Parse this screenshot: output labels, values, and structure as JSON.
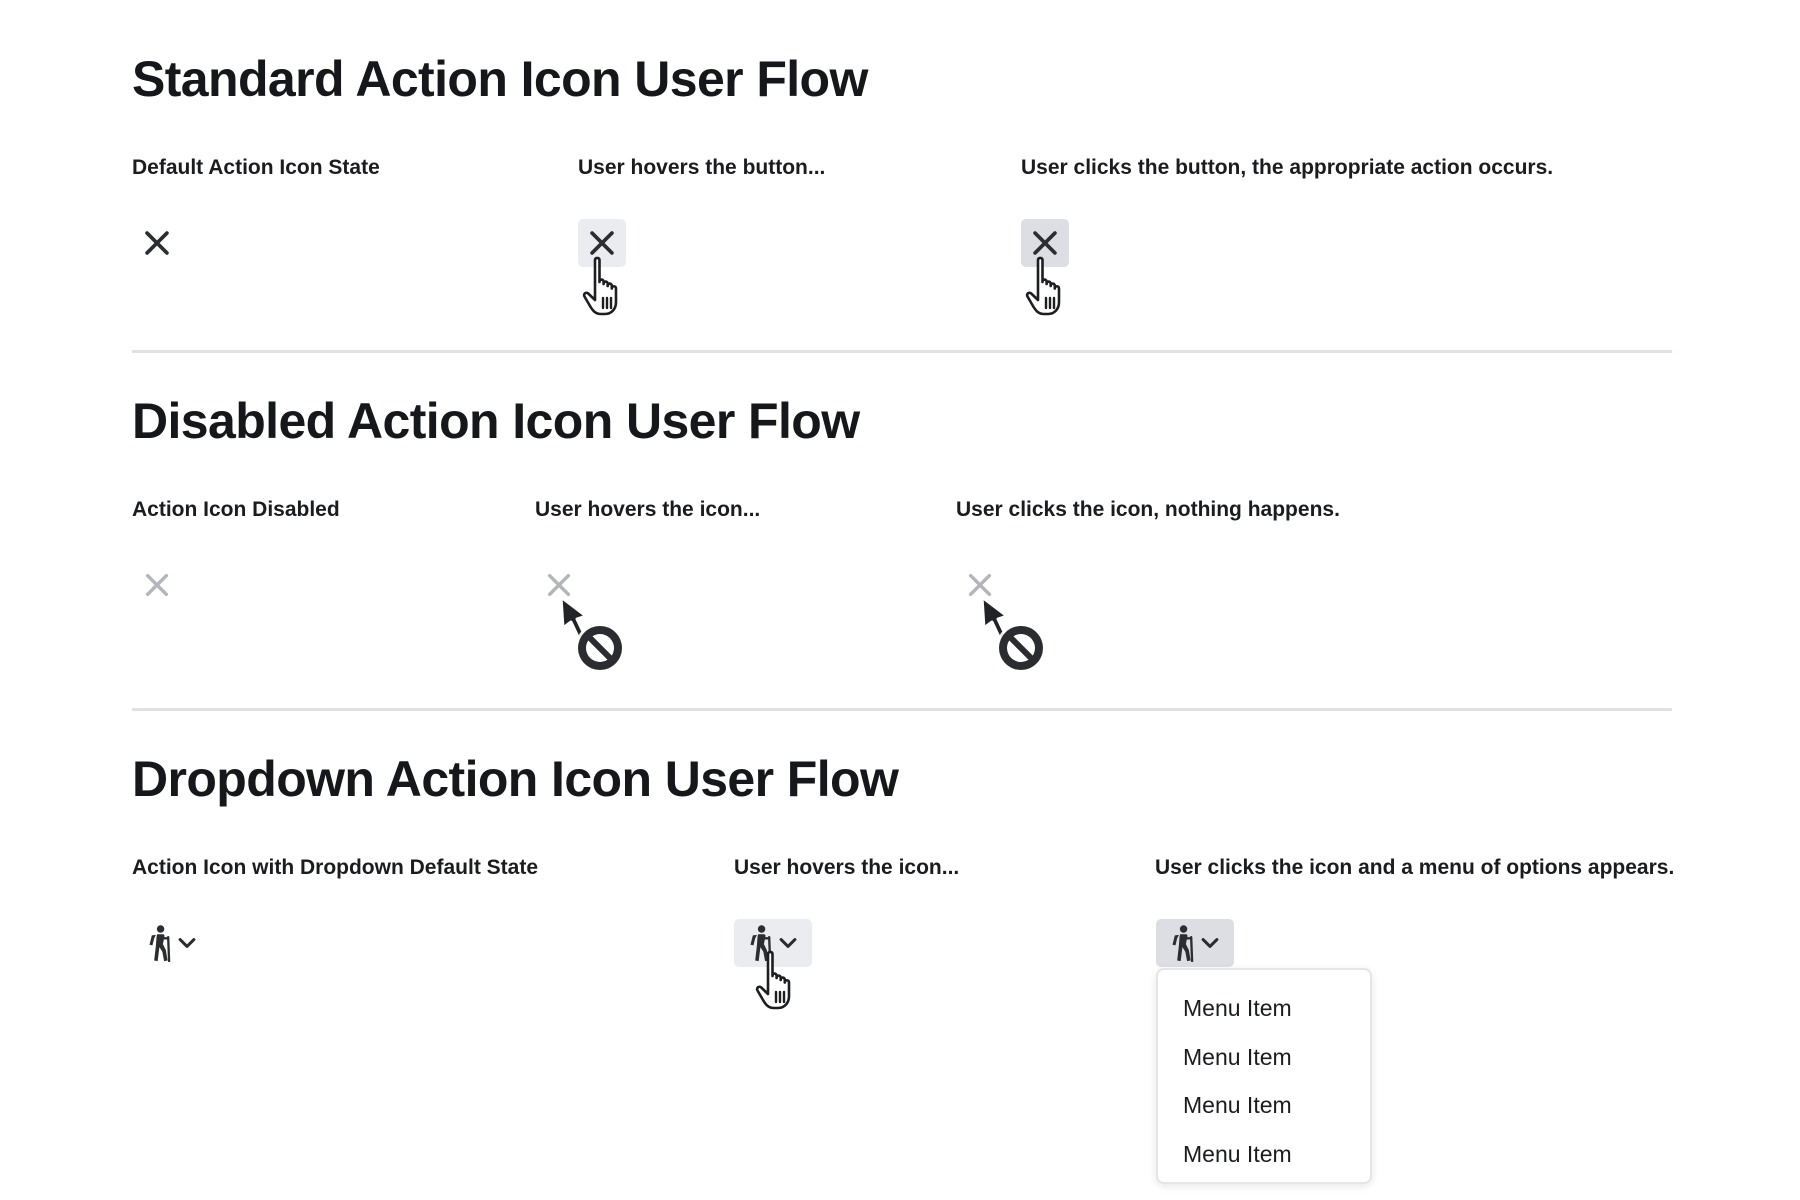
{
  "sections": [
    {
      "title": "Standard Action Icon User Flow",
      "steps": [
        {
          "caption": "Default Action Icon State"
        },
        {
          "caption": "User hovers the button..."
        },
        {
          "caption": "User clicks the button, the appropriate action occurs."
        }
      ]
    },
    {
      "title": "Disabled Action Icon User Flow",
      "steps": [
        {
          "caption": "Action Icon Disabled"
        },
        {
          "caption": "User hovers the icon..."
        },
        {
          "caption": "User clicks the icon, nothing happens."
        }
      ]
    },
    {
      "title": "Dropdown Action Icon User Flow",
      "steps": [
        {
          "caption": "Action Icon with Dropdown Default State"
        },
        {
          "caption": "User hovers the icon..."
        },
        {
          "caption": "User clicks the icon and a menu of options appears."
        }
      ]
    }
  ],
  "menu": {
    "items": [
      "Menu Item",
      "Menu Item",
      "Menu Item",
      "Menu Item"
    ]
  },
  "icons": {
    "close": "close-icon",
    "hiker": "hiker-icon",
    "chevron": "chevron-down-icon",
    "pointer_hand": "hand-pointer-cursor-icon",
    "not_allowed": "not-allowed-cursor-icon"
  },
  "colors": {
    "text": "#1b1c1f",
    "icon": "#2b2d31",
    "icon_disabled": "#b3b5ba",
    "hover_bg": "#ebecf0",
    "pressed_bg": "#dcdee3",
    "divider": "#dfe1e6",
    "menu_border": "#e3e5e9"
  }
}
